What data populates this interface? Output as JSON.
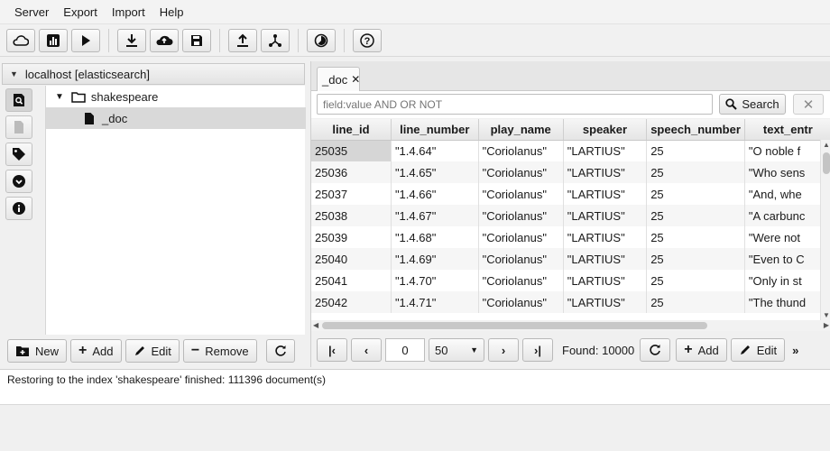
{
  "menu": [
    "Server",
    "Export",
    "Import",
    "Help"
  ],
  "toolbar": {
    "group1": [
      "cloud-icon",
      "chart-icon",
      "play-icon"
    ],
    "group2": [
      "download-icon",
      "cloud-upload-icon",
      "save-icon"
    ],
    "group3": [
      "upload-icon",
      "share-icon"
    ],
    "group4": [
      "pie-icon"
    ],
    "group5": [
      "help-icon"
    ]
  },
  "left": {
    "header": "localhost [elasticsearch]",
    "tree": {
      "index": "shakespeare",
      "type": "_doc"
    },
    "buttons": {
      "new": "New",
      "add": "Add",
      "edit": "Edit",
      "remove": "Remove"
    }
  },
  "right": {
    "tab": "_doc",
    "search": {
      "placeholder": "field:value AND OR NOT",
      "button": "Search"
    },
    "columns": [
      "line_id",
      "line_number",
      "play_name",
      "speaker",
      "speech_number",
      "text_entr"
    ],
    "rows": [
      [
        "25035",
        "\"1.4.64\"",
        "\"Coriolanus\"",
        "\"LARTIUS\"",
        "25",
        "\"O noble f"
      ],
      [
        "25036",
        "\"1.4.65\"",
        "\"Coriolanus\"",
        "\"LARTIUS\"",
        "25",
        "\"Who sens"
      ],
      [
        "25037",
        "\"1.4.66\"",
        "\"Coriolanus\"",
        "\"LARTIUS\"",
        "25",
        "\"And, whe"
      ],
      [
        "25038",
        "\"1.4.67\"",
        "\"Coriolanus\"",
        "\"LARTIUS\"",
        "25",
        "\"A carbunc"
      ],
      [
        "25039",
        "\"1.4.68\"",
        "\"Coriolanus\"",
        "\"LARTIUS\"",
        "25",
        "\"Were not"
      ],
      [
        "25040",
        "\"1.4.69\"",
        "\"Coriolanus\"",
        "\"LARTIUS\"",
        "25",
        "\"Even to C"
      ],
      [
        "25041",
        "\"1.4.70\"",
        "\"Coriolanus\"",
        "\"LARTIUS\"",
        "25",
        "\"Only in st"
      ],
      [
        "25042",
        "\"1.4.71\"",
        "\"Coriolanus\"",
        "\"LARTIUS\"",
        "25",
        "\"The thund"
      ]
    ],
    "pager": {
      "page": "0",
      "size": "50",
      "found": "Found: 10000",
      "add": "Add",
      "edit": "Edit"
    }
  },
  "status": "Restoring to the index 'shakespeare' finished: 111396 document(s)"
}
